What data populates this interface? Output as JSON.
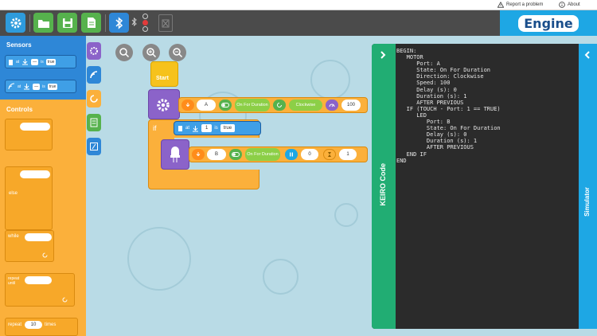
{
  "topbar": {
    "report_label": "Report a problem",
    "about_label": "About"
  },
  "toolbar": {
    "buttons": [
      "settings-icon",
      "open-folder-icon",
      "save-icon",
      "new-file-icon",
      "bluetooth-icon",
      "trash-icon"
    ],
    "logo_text": "Engine"
  },
  "colors": {
    "toolbar_bg": "#4b4b4b",
    "green": "#56b24d",
    "blue": "#2e87d7",
    "orange": "#fbb03b",
    "purple": "#8b63c9",
    "code_bg": "#2b2b2b",
    "code_tab": "#21ad73",
    "sim_tab": "#1ea7e4",
    "workspace_bg": "#b9dbe6"
  },
  "sidebar": {
    "sensors_title": "Sensors",
    "sensor_blocks": [
      {
        "at": "at",
        "port": "—",
        "is": "is",
        "value": "true"
      },
      {
        "at": "at",
        "port": "—",
        "is": "is",
        "value": "true"
      }
    ],
    "controls_title": "Controls",
    "controls": {
      "else_label": "else",
      "while_label": "while",
      "repeat_until_label": "repeat until",
      "repeat_label": "repeat",
      "repeat_count": "10",
      "times_label": "times"
    }
  },
  "canvas": {
    "start_label": "Start",
    "motor_block": {
      "port": "A",
      "state": "On For Duration",
      "direction": "Clockwise",
      "speed": "100"
    },
    "if_block": {
      "if_label": "if",
      "sensor_at": "at",
      "sensor_port": "1",
      "sensor_is": "is",
      "sensor_value": "true"
    },
    "led_block": {
      "port": "B",
      "state": "On For Duration",
      "delay": "0",
      "duration": "1"
    }
  },
  "code_panel": {
    "tab_label": "KEIRO Code",
    "lines": [
      "BEGIN:",
      "   MOTOR",
      "      Port: A",
      "      State: On For Duration",
      "      Direction: Clockwise",
      "      Speed: 100",
      "      Delay (s): 0",
      "      Duration (s): 1",
      "      AFTER PREVIOUS",
      "   IF (TOUCH - Port: 1 == TRUE)",
      "      LED",
      "         Port: B",
      "         State: On For Duration",
      "         Delay (s): 0",
      "         Duration (s): 1",
      "         AFTER PREVIOUS",
      "   END IF",
      "END"
    ]
  },
  "sim_panel": {
    "tab_label": "Simulator"
  }
}
